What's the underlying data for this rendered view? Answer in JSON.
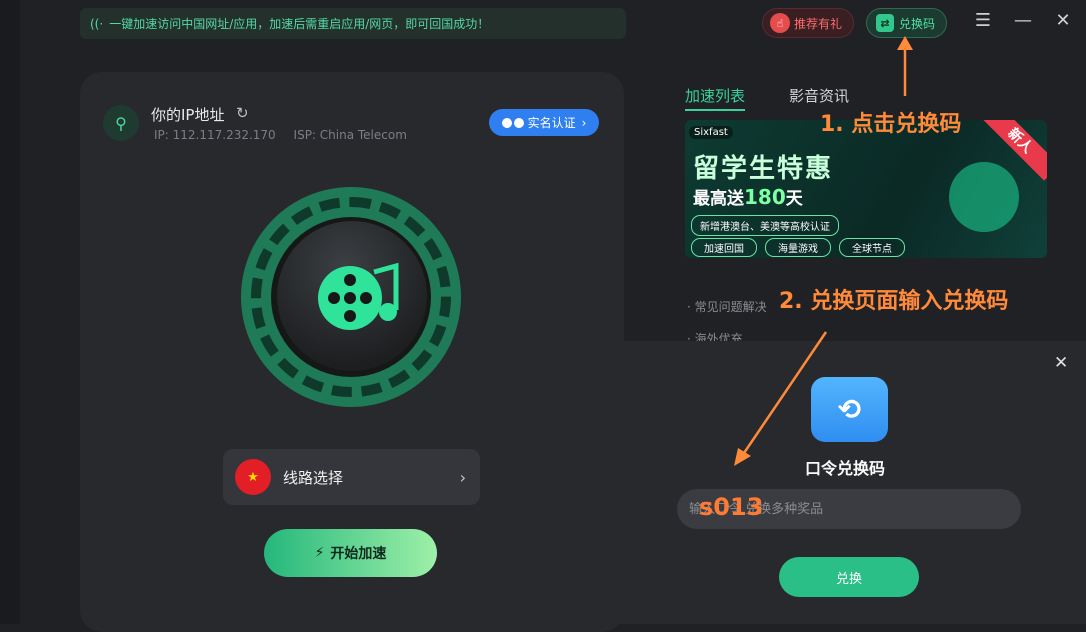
{
  "notice": {
    "text": "一键加速访问中国网址/应用，加速后需重启应用/网页，即可回国成功！"
  },
  "topbar": {
    "refer_label": "推荐有礼",
    "redeem_label": "兑换码"
  },
  "ip": {
    "title": "你的IP地址",
    "ip_text": "IP: 112.117.232.170",
    "isp_text": "ISP: China Telecom",
    "verify_label": "实名认证"
  },
  "route": {
    "label": "线路选择"
  },
  "start": {
    "label": "开始加速"
  },
  "tabs": [
    "加速列表",
    "影音资讯"
  ],
  "banner": {
    "brand": "Sixfast",
    "headline": "留学生特惠",
    "sub_prefix": "最高送",
    "sub_num": "180",
    "sub_suffix": "天",
    "note": "新增港澳台、美澳等高校认证",
    "chips": [
      "加速回国",
      "海量游戏",
      "全球节点"
    ],
    "tag": "新人"
  },
  "faq": [
    "· 常见问题解决",
    "· 海外优充"
  ],
  "redeem_dialog": {
    "title": "口令兑换码",
    "placeholder": "输入口令 兑换多种奖品",
    "typed": "s013",
    "button": "兑换"
  },
  "annotations": {
    "step1": "1. 点击兑换码",
    "step2": "2. 兑换页面输入兑换码"
  },
  "colors": {
    "accent": "#37d39a",
    "annotation": "#ff8a3a",
    "button": "#2bbf88"
  }
}
